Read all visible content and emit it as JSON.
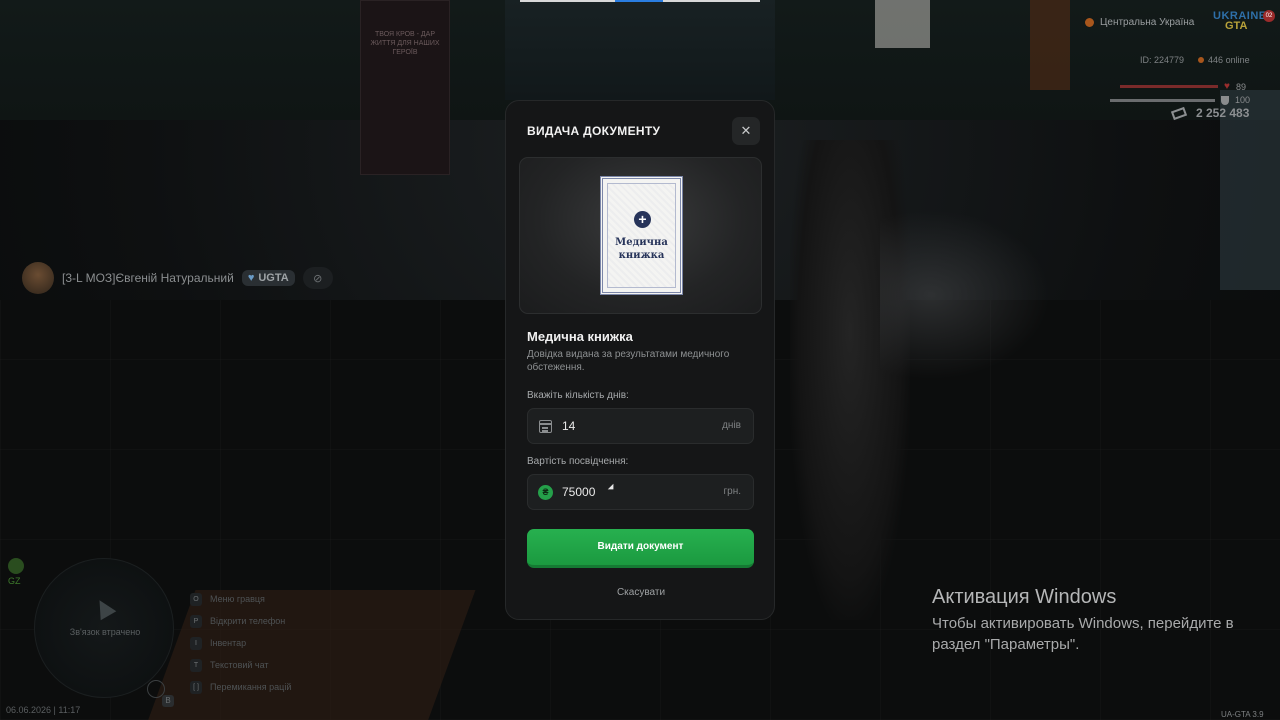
{
  "background": {
    "poster_text": "ТВОЯ КРОВ - ДАР ЖИТТЯ ДЛЯ НАШИХ ГЕРОЇВ"
  },
  "hud": {
    "region": "Центральна Україна",
    "logo_line1": "UKRAINE",
    "logo_line2": "GTA",
    "logo_badge": "02",
    "player_id": "ID: 224779",
    "online": "446 online",
    "health": "89",
    "armor": "100",
    "money": "2 252 483",
    "chat_name": "[3-L МОЗ]Євгеній Натуральний",
    "chat_tag": "UGTA",
    "minimap_text": "Зв'язок втрачено",
    "voice_label": "GZ",
    "datetime": "06.06.2026 | 11:17",
    "mic_key": "B",
    "keybinds": [
      {
        "key": "O",
        "label": "Меню гравця"
      },
      {
        "key": "P",
        "label": "Відкрити телефон"
      },
      {
        "key": "I",
        "label": "Інвентар"
      },
      {
        "key": "T",
        "label": "Текстовий чат"
      },
      {
        "key": "[ ]",
        "label": "Перемикання рацій"
      }
    ],
    "version": "UA-GTA 3.9"
  },
  "windows_activation": {
    "title": "Активация Windows",
    "text": "Чтобы активировать Windows, перейдите в раздел \"Параметры\"."
  },
  "modal": {
    "title": "ВИДАЧА ДОКУМЕНТУ",
    "close_symbol": "✕",
    "document_preview_title": "Медична книжка",
    "document_preview_plus": "+",
    "item_name": "Медична книжка",
    "item_description": "Довідка видана за результатами медичного обстеження.",
    "days_label": "Вкажіть кількість днів:",
    "days_value": "14",
    "days_unit": "днів",
    "cost_label": "Вартість посвідчення:",
    "cost_value": "75000",
    "cost_unit": "грн.",
    "currency_symbol": "₴",
    "submit_label": "Видати документ",
    "cancel_label": "Скасувати"
  },
  "colors": {
    "accent_green": "#1f9f45",
    "modal_bg": "#151617",
    "health_red": "#7a2a2a"
  }
}
